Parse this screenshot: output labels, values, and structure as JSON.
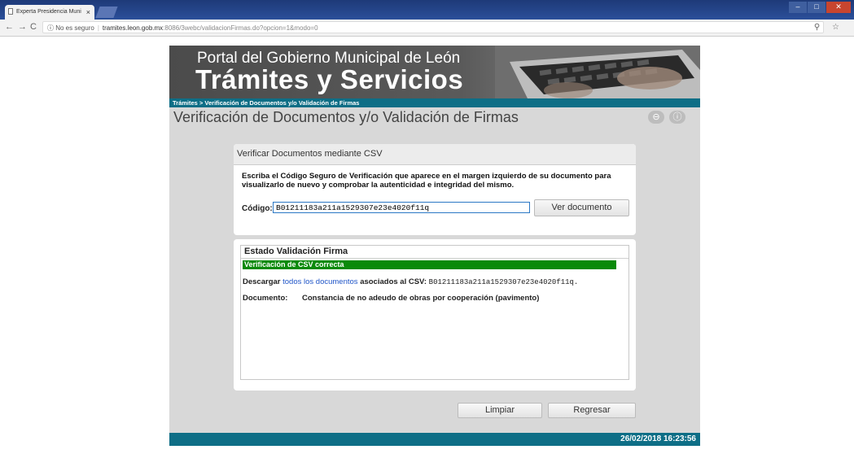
{
  "browser": {
    "tab_title": "Experta Presidencia Muni",
    "tab_close": "×",
    "security": "No es seguro",
    "url_host": "tramites.leon.gob.mx",
    "url_path": ":8086/3webc/validacionFirmas.do?opcion=1&modo=0",
    "url_icons": "⚲ ☆"
  },
  "banner": {
    "subtitle": "Portal del Gobierno Municipal de León",
    "title": "Trámites y Servicios"
  },
  "breadcrumb": "Trámites > Verificación de Documentos y/o Validación de Firmas",
  "page_title": "Verificación de Documentos y/o Validación de Firmas",
  "csv_panel": {
    "header": "Verificar Documentos mediante CSV",
    "instructions": "Escriba el Código Seguro de Verificación que aparece en el margen izquierdo de su documento para visualizarlo de nuevo y comprobar la autenticidad e integridad del mismo.",
    "code_label": "Código:",
    "code_value": "B01211183a211a1529307e23e4020f11q",
    "view_button": "Ver documento"
  },
  "status_panel": {
    "title": "Estado Validación Firma",
    "success_message": "Verificación de CSV correcta",
    "download_prefix": "Descargar",
    "download_link": "todos los documentos",
    "download_middle": "asociados al CSV:",
    "csv_code": "B01211183a211a1529307e23e4020f11q.",
    "document_label": "Documento:",
    "document_value": "Constancia de no adeudo de obras por cooperación (pavimento)"
  },
  "actions": {
    "clear_button": "Limpiar",
    "back_button": "Regresar"
  },
  "footer_timestamp": "26/02/2018 16:23:56",
  "colors": {
    "accent": "#0e6e86",
    "success": "#0a8a0a",
    "link": "#2156c8"
  }
}
